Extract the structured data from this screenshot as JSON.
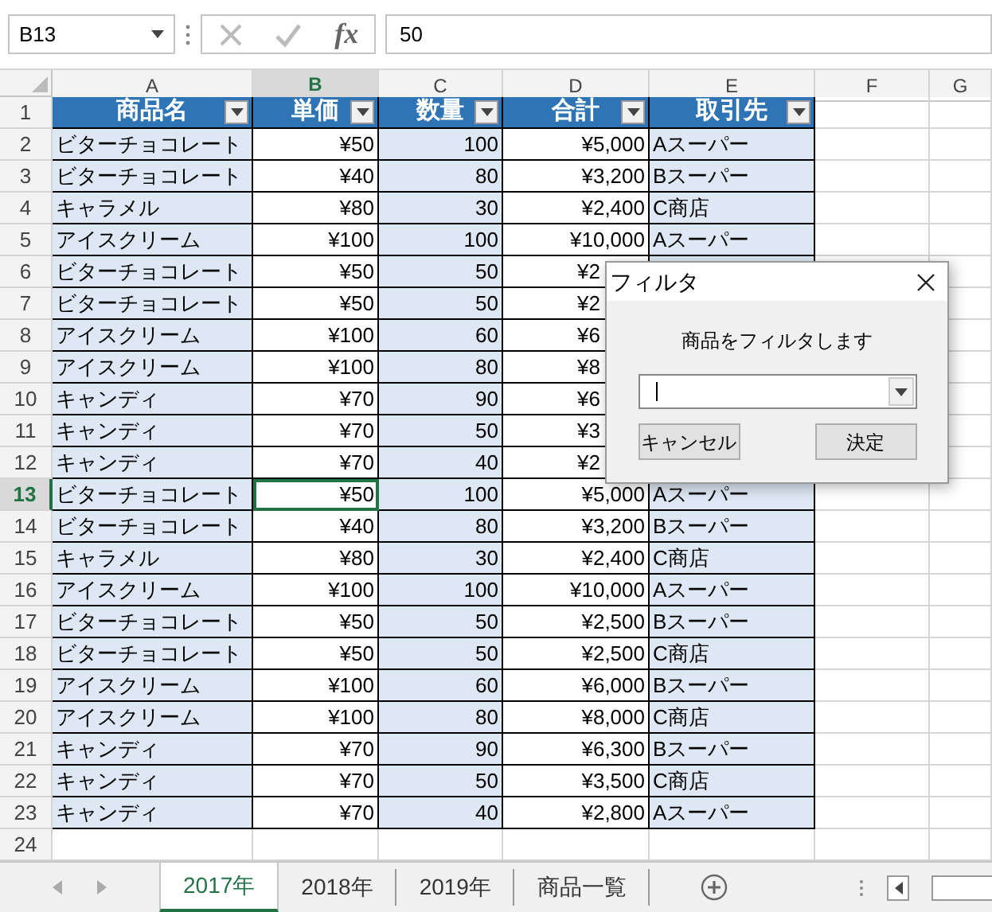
{
  "formula_bar": {
    "name_box": "B13",
    "function_label": "fx",
    "formula": "50"
  },
  "columns": [
    {
      "label": "A",
      "selected": false
    },
    {
      "label": "B",
      "selected": true
    },
    {
      "label": "C",
      "selected": false
    },
    {
      "label": "D",
      "selected": false
    },
    {
      "label": "E",
      "selected": false
    },
    {
      "label": "F",
      "selected": false
    },
    {
      "label": "G",
      "selected": false
    }
  ],
  "table": {
    "headers": [
      "商品名",
      "単価",
      "数量",
      "合計",
      "取引先"
    ],
    "rows": [
      {
        "num": "2",
        "cells": [
          "ビターチョコレート",
          "¥50",
          "100",
          "¥5,000",
          "Aスーパー"
        ],
        "selected": false,
        "covered": false
      },
      {
        "num": "3",
        "cells": [
          "ビターチョコレート",
          "¥40",
          "80",
          "¥3,200",
          "Bスーパー"
        ],
        "selected": false,
        "covered": false
      },
      {
        "num": "4",
        "cells": [
          "キャラメル",
          "¥80",
          "30",
          "¥2,400",
          "C商店"
        ],
        "selected": false,
        "covered": false
      },
      {
        "num": "5",
        "cells": [
          "アイスクリーム",
          "¥100",
          "100",
          "¥10,000",
          "Aスーパー"
        ],
        "selected": false,
        "covered": false
      },
      {
        "num": "6",
        "cells": [
          "ビターチョコレート",
          "¥50",
          "50",
          "¥2"
        ],
        "selected": false,
        "covered": true
      },
      {
        "num": "7",
        "cells": [
          "ビターチョコレート",
          "¥50",
          "50",
          "¥2"
        ],
        "selected": false,
        "covered": true
      },
      {
        "num": "8",
        "cells": [
          "アイスクリーム",
          "¥100",
          "60",
          "¥6"
        ],
        "selected": false,
        "covered": true
      },
      {
        "num": "9",
        "cells": [
          "アイスクリーム",
          "¥100",
          "80",
          "¥8"
        ],
        "selected": false,
        "covered": true
      },
      {
        "num": "10",
        "cells": [
          "キャンディ",
          "¥70",
          "90",
          "¥6"
        ],
        "selected": false,
        "covered": true
      },
      {
        "num": "11",
        "cells": [
          "キャンディ",
          "¥70",
          "50",
          "¥3"
        ],
        "selected": false,
        "covered": true
      },
      {
        "num": "12",
        "cells": [
          "キャンディ",
          "¥70",
          "40",
          "¥2"
        ],
        "selected": false,
        "covered": true
      },
      {
        "num": "13",
        "cells": [
          "ビターチョコレート",
          "¥50",
          "100",
          "¥5,000",
          "Aスーパー"
        ],
        "selected": true,
        "covered": false
      },
      {
        "num": "14",
        "cells": [
          "ビターチョコレート",
          "¥40",
          "80",
          "¥3,200",
          "Bスーパー"
        ],
        "selected": false,
        "covered": false
      },
      {
        "num": "15",
        "cells": [
          "キャラメル",
          "¥80",
          "30",
          "¥2,400",
          "C商店"
        ],
        "selected": false,
        "covered": false
      },
      {
        "num": "16",
        "cells": [
          "アイスクリーム",
          "¥100",
          "100",
          "¥10,000",
          "Aスーパー"
        ],
        "selected": false,
        "covered": false
      },
      {
        "num": "17",
        "cells": [
          "ビターチョコレート",
          "¥50",
          "50",
          "¥2,500",
          "Bスーパー"
        ],
        "selected": false,
        "covered": false
      },
      {
        "num": "18",
        "cells": [
          "ビターチョコレート",
          "¥50",
          "50",
          "¥2,500",
          "C商店"
        ],
        "selected": false,
        "covered": false
      },
      {
        "num": "19",
        "cells": [
          "アイスクリーム",
          "¥100",
          "60",
          "¥6,000",
          "Bスーパー"
        ],
        "selected": false,
        "covered": false
      },
      {
        "num": "20",
        "cells": [
          "アイスクリーム",
          "¥100",
          "80",
          "¥8,000",
          "C商店"
        ],
        "selected": false,
        "covered": false
      },
      {
        "num": "21",
        "cells": [
          "キャンディ",
          "¥70",
          "90",
          "¥6,300",
          "Bスーパー"
        ],
        "selected": false,
        "covered": false
      },
      {
        "num": "22",
        "cells": [
          "キャンディ",
          "¥70",
          "50",
          "¥3,500",
          "C商店"
        ],
        "selected": false,
        "covered": false
      },
      {
        "num": "23",
        "cells": [
          "キャンディ",
          "¥70",
          "40",
          "¥2,800",
          "Aスーパー"
        ],
        "selected": false,
        "covered": false
      }
    ],
    "header_row_num": "1",
    "empty_row_num": "24"
  },
  "dialog": {
    "title": "フィルタ",
    "message": "商品をフィルタします",
    "buttons": [
      "キャンセル",
      "決定"
    ]
  },
  "sheet_tabs": [
    {
      "label": "2017年",
      "selected": true
    },
    {
      "label": "2018年",
      "selected": false
    },
    {
      "label": "2019年",
      "selected": false
    },
    {
      "label": "商品一覧",
      "selected": false
    }
  ]
}
